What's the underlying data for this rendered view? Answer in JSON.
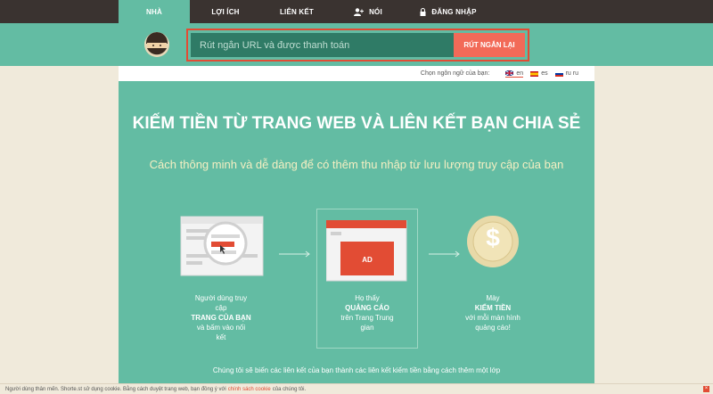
{
  "nav": {
    "items": [
      {
        "label": "NHÀ",
        "active": true
      },
      {
        "label": "LỢI ÍCH"
      },
      {
        "label": "LIÊN KẾT"
      },
      {
        "label": "NÓI",
        "icon": "user-plus-icon"
      },
      {
        "label": "ĐĂNG NHẬP",
        "icon": "lock-icon"
      }
    ]
  },
  "shortener": {
    "placeholder": "Rút ngắn URL và được thanh toán",
    "button_label": "RÚT NGẮN LẠI"
  },
  "language": {
    "prompt": "Chọn ngôn ngữ của bạn:",
    "options": [
      {
        "code": "en",
        "active": true
      },
      {
        "code": "es"
      },
      {
        "code": "ru ru"
      }
    ]
  },
  "hero": {
    "title": "KIẾM TIỀN TỪ TRANG WEB VÀ LIÊN KẾT BẠN CHIA SẺ",
    "subtitle": "Cách thông minh và dễ dàng để có thêm thu nhập từ lưu lượng truy cập của bạn"
  },
  "steps": [
    {
      "line1": "Người dùng truy",
      "line2": "cập",
      "bold": "TRANG CỦA BẠN",
      "line3": "và bấm vào nối",
      "line4": "kết"
    },
    {
      "line1": "Họ thấy",
      "bold": "QUẢNG CÁO",
      "line2": "trên Trang Trung",
      "line3": "gian",
      "ad_label": "AD"
    },
    {
      "line1": "Mày",
      "bold": "KIẾM TIỀN",
      "line2": "với mỗi màn hình",
      "line3": "quảng cáo!",
      "coin_symbol": "$"
    }
  ],
  "bottom_text": "Chúng tôi sẽ biến các liên kết của bạn thành các liên kết kiếm tiền bằng cách thêm một lớp",
  "cookie": {
    "text_before": "Người dùng thân mến. Shorte.st sử dụng cookie. Bằng cách duyệt trang web, bạn đồng ý với",
    "link": "chính sách cookie",
    "text_after": "của chúng tôi.",
    "close": "×"
  },
  "colors": {
    "nav_bg": "#3a3330",
    "teal": "#63bca3",
    "dark_teal": "#2f7b66",
    "accent_red": "#e24c34",
    "button_salmon": "#f26a58",
    "cream": "#f0eadb"
  }
}
